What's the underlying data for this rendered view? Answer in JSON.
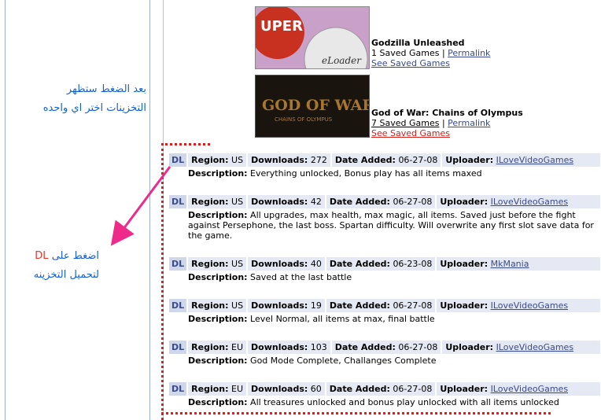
{
  "sidebar": {
    "note_line1": "بعد الضغط ستظهر",
    "note_line2": "التخزينات اختر  اي واحده",
    "dl_note_prefix": "اضغط على ",
    "dl_note_dl": "DL",
    "dl_note_line2": "لتحميل التخزينه"
  },
  "games": [
    {
      "title": "Godzilla Unleashed",
      "saved_count": "1 Saved Games",
      "separator": "|",
      "permalink": "Permalink",
      "see_saved": "See Saved Games",
      "thumb_text": "eLoader"
    },
    {
      "title": "God of War: Chains of Olympus",
      "saved_count": "7 Saved Games",
      "separator": "|",
      "permalink": "Permalink",
      "see_saved": "See Saved Games",
      "thumb_title": "GOD OF WAR",
      "thumb_sub": "CHAINS OF OLYMPUS"
    }
  ],
  "labels": {
    "dl": "DL",
    "region": "Region:",
    "downloads": "Downloads:",
    "date_added": "Date Added:",
    "uploader": "Uploader:",
    "description": "Description:"
  },
  "entries": [
    {
      "region": "US",
      "downloads": "272",
      "date": "06-27-08",
      "uploader": "ILoveVideoGames",
      "description": "Everything unlocked, Bonus play has all items maxed"
    },
    {
      "region": "US",
      "downloads": "42",
      "date": "06-27-08",
      "uploader": "ILoveVideoGames",
      "description": "All upgrades, max health, max magic, all items. Saved just before the fight against Persephone, the last boss. Spartan difficulty. Will overwrite any first slot save data for the game."
    },
    {
      "region": "US",
      "downloads": "40",
      "date": "06-23-08",
      "uploader": "MkMania",
      "description": "Saved at the last battle"
    },
    {
      "region": "US",
      "downloads": "19",
      "date": "06-27-08",
      "uploader": "ILoveVideoGames",
      "description": "Level Normal, all items at max, final battle"
    },
    {
      "region": "EU",
      "downloads": "103",
      "date": "06-27-08",
      "uploader": "ILoveVideoGames",
      "description": "God Mode Complete, Challanges Complete"
    },
    {
      "region": "EU",
      "downloads": "60",
      "date": "06-27-08",
      "uploader": "ILoveVideoGames",
      "description": "All treasures unlocked and bonus play unlocked with all items unlocked"
    }
  ]
}
